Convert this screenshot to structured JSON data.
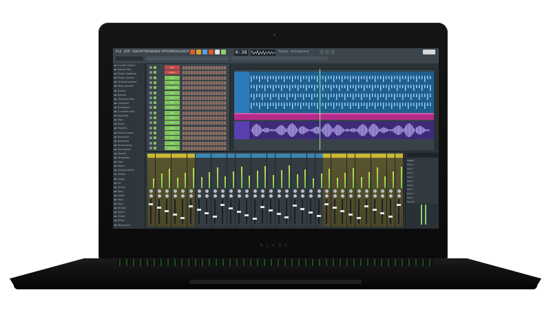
{
  "device": {
    "brand_text": "BLADE"
  },
  "app": {
    "tempo_display": "0:38",
    "playlist_title": "Playlist - Arrangement",
    "toolbar_items": [
      "FILE",
      "EDIT",
      "ADD",
      "PATTERNS",
      "VIEW",
      "OPTIONS",
      "TOOLS",
      "HELP"
    ]
  },
  "browser": {
    "items": [
      "Current project",
      "Recent files",
      "Plugin database",
      "Plugin presets",
      "Channel presets",
      "Mixer presets",
      "Scores",
      "Backup",
      "Clipboard files",
      "Collected",
      "Envelopes",
      "IL shared data",
      "Impulses",
      "Misc",
      "Packs",
      "Projects",
      "Project bones",
      "Recorded",
      "Rendered",
      "Sliced beats",
      "Soundfonts",
      "Speech",
      "Templates",
      "User",
      "Video",
      "Sample packs",
      "Drums",
      "Loops",
      "FX",
      "Vocals",
      "Bass",
      "Leads",
      "Pads",
      "Keys",
      "Strings",
      "Synth",
      "Guitar",
      "Brass",
      "Percussion"
    ]
  },
  "channel_rack": {
    "channels": [
      "Kick",
      "Snare",
      "Clap",
      "Hat",
      "Open hat",
      "Ride",
      "Crash",
      "Tom",
      "Bass",
      "Sub",
      "Lead",
      "Pad",
      "Pluck",
      "Keys",
      "FX",
      "Vox",
      "Chords"
    ],
    "accent_colors": [
      "#c44a4a",
      "#c44a4a",
      "#7dc45a",
      "#7dc45a",
      "#7dc45a",
      "#7dc45a",
      "#7dc45a",
      "#7dc45a",
      "#7dc45a",
      "#7dc45a",
      "#7dc45a",
      "#7dc45a",
      "#7dc45a",
      "#7dc45a",
      "#7dc45a",
      "#7dc45a",
      "#7dc45a"
    ]
  },
  "mixer": {
    "strip_colors": [
      "#c9b833",
      "#c9b833",
      "#c9b833",
      "#c9b833",
      "#c9b833",
      "#c9b833",
      "#3c86b5",
      "#3c86b5",
      "#3c86b5",
      "#3c86b5",
      "#3c86b5",
      "#3c86b5",
      "#3c86b5",
      "#3c86b5",
      "#3c86b5",
      "#3c86b5",
      "#3c86b5",
      "#3c86b5",
      "#3c86b5",
      "#3c86b5",
      "#3c86b5",
      "#3c86b5",
      "#c9b833",
      "#c9b833",
      "#c9b833",
      "#c9b833",
      "#c9b833",
      "#c9b833",
      "#c9b833",
      "#c9b833",
      "#c9b833",
      "#c9b833"
    ]
  },
  "inspector": {
    "items": [
      "Master",
      "Slot 1",
      "Slot 2",
      "Slot 3",
      "Slot 4",
      "Slot 5",
      "Slot 6",
      "Slot 7",
      "Slot 8",
      "Slot 9",
      "Slot 10"
    ]
  },
  "colors": {
    "accent_blue": "#2f7bb6",
    "accent_green": "#7dc45a",
    "accent_purple": "#6b3fa0",
    "accent_orange": "#e0702f"
  }
}
